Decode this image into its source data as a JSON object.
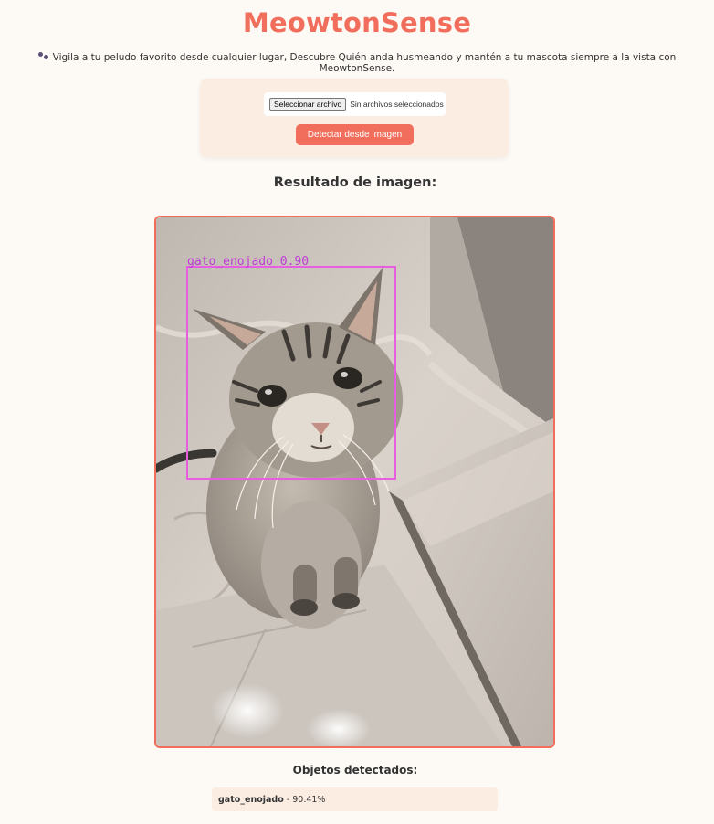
{
  "header": {
    "title": "MeowtonSense",
    "subtitle": "Vigila a tu peludo favorito desde cualquier lugar, Descubre Quién anda husmeando y mantén a tu mascota siempre a la vista con MeowtonSense.",
    "paw_icon": "paw-icon"
  },
  "upload": {
    "file_button_label": "Seleccionar archivo",
    "file_status": "Sin archivos seleccionados",
    "detect_button_label": "Detectar desde imagen"
  },
  "result": {
    "title": "Resultado de imagen:",
    "detection_label": "gato_enojado 0.90"
  },
  "detections": {
    "title": "Objetos detectados:",
    "items": [
      {
        "class_name": "gato_enojado",
        "separator": " - ",
        "confidence": "90.41%"
      }
    ]
  },
  "colors": {
    "accent": "#f26e5c",
    "card_background": "#fcede3",
    "page_background": "#fdf9f5",
    "bbox": "#e85ee0"
  }
}
